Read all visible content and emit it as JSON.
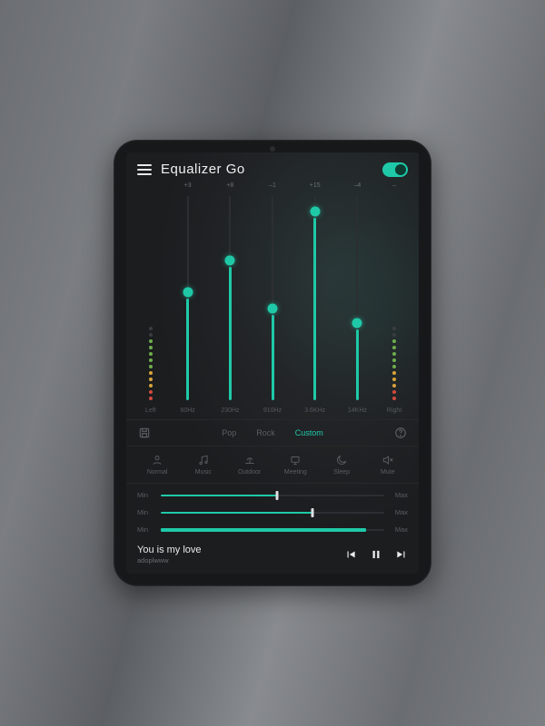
{
  "header": {
    "title": "Equalizer Go",
    "toggle_on": true
  },
  "eq": {
    "left_label": "Left",
    "right_label": "Right",
    "left_value": "",
    "right_value": "–",
    "bands": [
      {
        "freq": "60Hz",
        "value": "+3",
        "pct": 50
      },
      {
        "freq": "230Hz",
        "value": "+8",
        "pct": 65
      },
      {
        "freq": "910Hz",
        "value": "–1",
        "pct": 42
      },
      {
        "freq": "3.6KHz",
        "value": "+15",
        "pct": 88
      },
      {
        "freq": "14KHz",
        "value": "–4",
        "pct": 35
      }
    ]
  },
  "presets": {
    "save_icon": "save",
    "help_icon": "help",
    "items": [
      {
        "label": "Pop",
        "active": false
      },
      {
        "label": "Rock",
        "active": false
      },
      {
        "label": "Custom",
        "active": true
      }
    ]
  },
  "modes": [
    {
      "key": "normal",
      "label": "Normal"
    },
    {
      "key": "music",
      "label": "Music"
    },
    {
      "key": "outdoor",
      "label": "Outdoor"
    },
    {
      "key": "meeting",
      "label": "Meeting"
    },
    {
      "key": "sleep",
      "label": "Sleep"
    },
    {
      "key": "mute",
      "label": "Mute"
    }
  ],
  "sliders": [
    {
      "min": "Min",
      "max": "Max",
      "pct": 52,
      "knob": true
    },
    {
      "min": "Min",
      "max": "Max",
      "pct": 68,
      "knob": true
    },
    {
      "min": "Min",
      "max": "Max",
      "pct": 92,
      "knob": false,
      "thick": true
    }
  ],
  "now_playing": {
    "title": "You is my love",
    "artist": "adoplwww"
  },
  "colors": {
    "accent": "#1fc9a8"
  }
}
